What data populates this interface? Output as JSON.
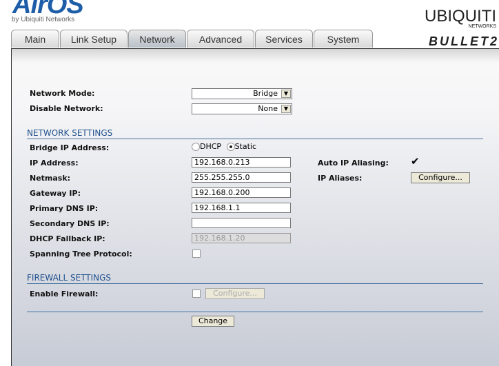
{
  "header": {
    "logo": "AirOS",
    "byline": "by Ubiquiti Networks",
    "brand": "UBIQUITI",
    "brand_sub": "NETWORKS",
    "product": "BULLET2"
  },
  "tabs": [
    {
      "label": "Main"
    },
    {
      "label": "Link Setup"
    },
    {
      "label": "Network"
    },
    {
      "label": "Advanced"
    },
    {
      "label": "Services"
    },
    {
      "label": "System"
    }
  ],
  "form": {
    "network_mode": {
      "label": "Network Mode:",
      "value": "Bridge"
    },
    "disable_network": {
      "label": "Disable Network:",
      "value": "None"
    },
    "network_settings": "NETWORK SETTINGS",
    "bridge_ip": {
      "label": "Bridge IP Address:",
      "opt1": "DHCP",
      "opt2": "Static"
    },
    "ip": {
      "label": "IP Address:",
      "value": "192.168.0.213"
    },
    "netmask": {
      "label": "Netmask:",
      "value": "255.255.255.0"
    },
    "gateway": {
      "label": "Gateway IP:",
      "value": "192.168.0.200"
    },
    "dns1": {
      "label": "Primary DNS IP:",
      "value": "192.168.1.1"
    },
    "dns2": {
      "label": "Secondary DNS IP:",
      "value": ""
    },
    "fallback": {
      "label": "DHCP Fallback IP:",
      "value": "192.168.1.20"
    },
    "stp": {
      "label": "Spanning Tree Protocol:"
    },
    "auto_alias": {
      "label": "Auto IP Aliasing:",
      "checked": true
    },
    "aliases": {
      "label": "IP Aliases:",
      "button": "Configure..."
    },
    "firewall_settings": "FIREWALL SETTINGS",
    "firewall": {
      "label": "Enable Firewall:",
      "button": "Configure..."
    },
    "change": "Change"
  }
}
